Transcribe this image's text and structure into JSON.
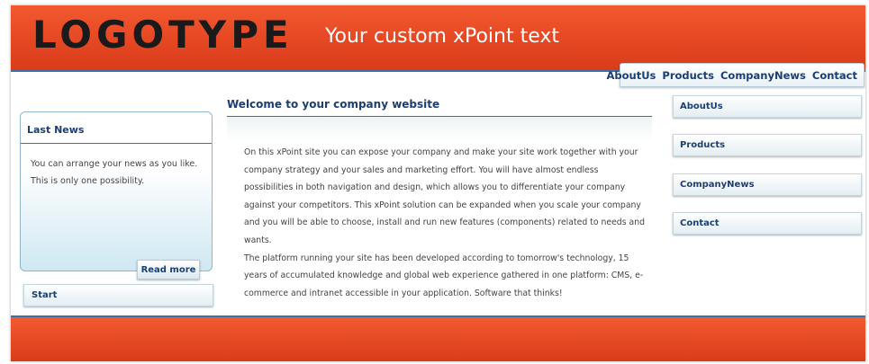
{
  "header": {
    "logo": "LOGOTYPE",
    "tagline": "Your custom xPoint text"
  },
  "top_nav": [
    "AboutUs",
    "Products",
    "CompanyNews",
    "Contact"
  ],
  "news": {
    "title": "Last News",
    "text": "You can arrange your news as you like. This is only one possibility.",
    "read_more": "Read more"
  },
  "left_nav": {
    "start": "Start"
  },
  "main": {
    "title": "Welcome to your company website",
    "paragraphs": [
      "On this xPoint site you can expose your company and make your site work together with your company strategy and your sales and marketing effort. You will have almost endless possibilities in both navigation and design, which allows you to differentiate your company against your competitors. This xPoint solution can be expanded when you scale your company and you will be able to choose, install and run new features (components) related to needs and wants.",
      "The platform running your site has been developed according to tomorrow's technology, 15 years of accumulated knowledge and global web experience gathered in one platform: CMS, e-commerce and intranet accessible in your application. Software that thinks!"
    ]
  },
  "right_nav": [
    "AboutUs",
    "Products",
    "CompanyNews",
    "Contact"
  ],
  "colors": {
    "header_orange": "#e84a25",
    "nav_blue": "#1b3e73",
    "rule_blue": "#3e6fa6"
  }
}
